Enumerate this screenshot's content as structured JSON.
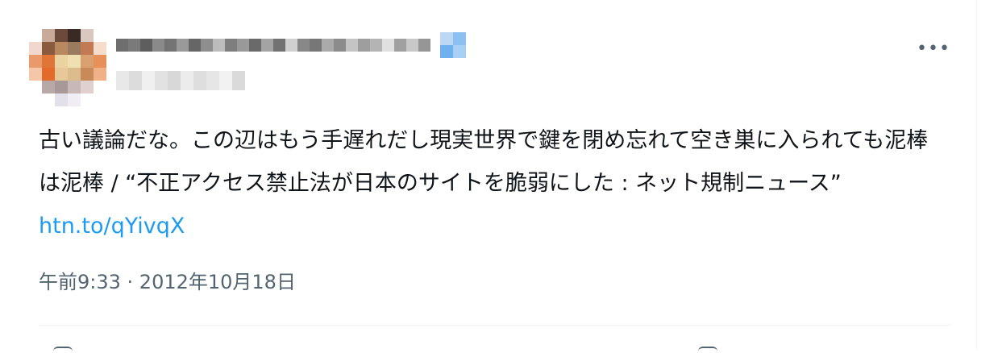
{
  "tweet": {
    "text": "古い議論だな。この辺はもう手遅れだし現実世界で鍵を閉め忘れて空き巣に入られても泥棒は泥棒 / “不正アクセス禁止法が日本のサイトを脆弱にした : ネット規制ニュース” ",
    "link": "htn.to/qYivqX",
    "time": "午前9:33",
    "separator": " · ",
    "date": "2012年10月18日"
  },
  "header": {
    "more_label": "•••",
    "more_icon": "more-horizontal-icon"
  },
  "colors": {
    "text": "#0f1419",
    "secondary": "#536471",
    "link": "#1d9bf0",
    "divider": "#eff3f4"
  }
}
